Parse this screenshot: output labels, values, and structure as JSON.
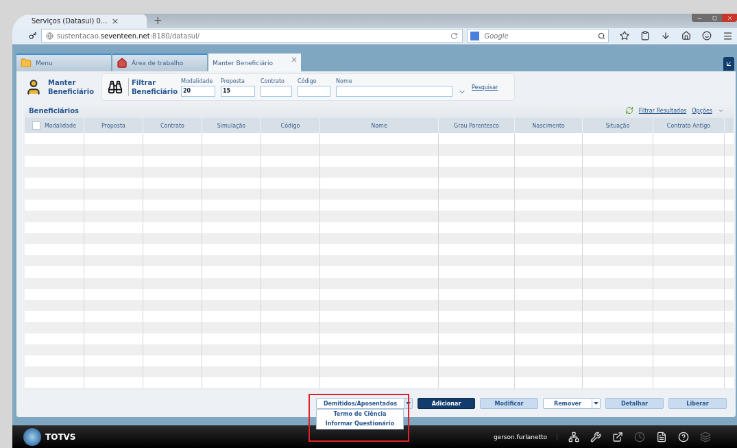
{
  "browser": {
    "tab_title": "Serviços (Datasul) 0...",
    "tab_close": "×",
    "new_tab": "+",
    "url": "sustentacao.**seventeen.net**:8180/datasul/",
    "search_placeholder": "Google"
  },
  "app_tabs": [
    {
      "label": "Menu",
      "kind": "folder",
      "selected": false
    },
    {
      "label": "Área de trabalho",
      "kind": "house",
      "selected": false
    },
    {
      "label": "Manter Beneficiário",
      "kind": "plain",
      "selected": true,
      "close": "×"
    }
  ],
  "header": {
    "title": "Manter Beneficiário",
    "filter_title": "Filtrar Beneficiário",
    "fields": [
      {
        "label": "Modalidade",
        "value": "20"
      },
      {
        "label": "Proposta",
        "value": "15"
      },
      {
        "label": "Contrato"
      },
      {
        "label": "Código"
      },
      {
        "label": "Nome"
      }
    ],
    "search_link": "Pesquisar"
  },
  "grid": {
    "title": "Beneficiários",
    "filter_link": "Filtrar Resultados",
    "options_link": "Opções",
    "select_all": {
      "checked": false
    },
    "columns": [
      "Modalidade",
      "Proposta",
      "Contrato",
      "Simulação",
      "Código",
      "Nome",
      "Grau Parentesco",
      "Nascimento",
      "Situação",
      "Contrato Antigo"
    ]
  },
  "actions": [
    {
      "label": "Demitidos/Aposentados",
      "kind": "split",
      "open": true,
      "menu": [
        "Termo de Ciência",
        "Informar Questionário"
      ]
    },
    {
      "label": "Adicionar",
      "kind": "primary"
    },
    {
      "label": "Modificar",
      "kind": "secondary"
    },
    {
      "label": "Remover",
      "kind": "split",
      "open": false
    },
    {
      "label": "Detalhar",
      "kind": "secondary"
    },
    {
      "label": "Liberar",
      "kind": "secondary"
    }
  ],
  "taskbar": {
    "brand": "TOTVS",
    "user": "gerson.furlanetto"
  }
}
